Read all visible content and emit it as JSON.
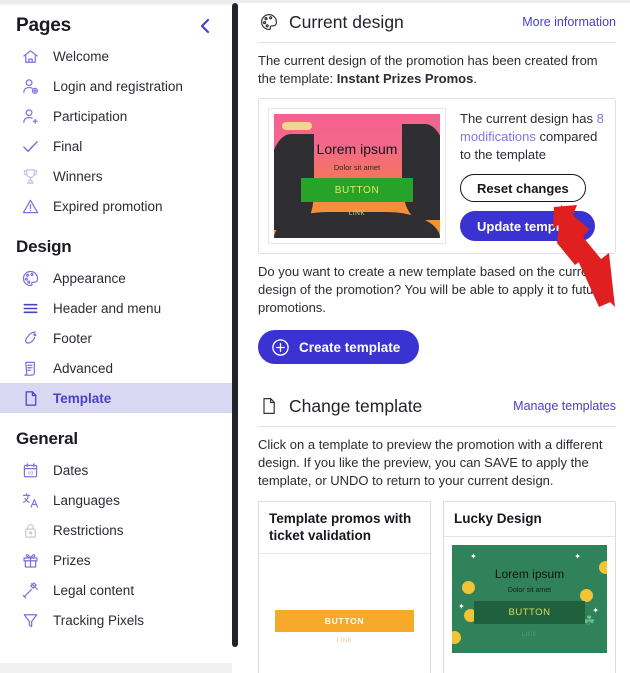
{
  "sidebar": {
    "title": "Pages",
    "collapse_icon": "chevron-left-icon",
    "groups": [
      {
        "heading": null,
        "items": [
          {
            "label": "Welcome",
            "icon": "home-icon",
            "active": false
          },
          {
            "label": "Login and registration",
            "icon": "user-login-icon",
            "active": false
          },
          {
            "label": "Participation",
            "icon": "user-add-icon",
            "active": false
          },
          {
            "label": "Final",
            "icon": "check-icon",
            "active": false
          },
          {
            "label": "Winners",
            "icon": "trophy-icon",
            "active": false
          },
          {
            "label": "Expired promotion",
            "icon": "warning-triangle-icon",
            "active": false
          }
        ]
      },
      {
        "heading": "Design",
        "items": [
          {
            "label": "Appearance",
            "icon": "palette-icon",
            "active": false
          },
          {
            "label": "Header and menu",
            "icon": "menu-lines-icon",
            "active": false
          },
          {
            "label": "Footer",
            "icon": "footer-icon",
            "active": false
          },
          {
            "label": "Advanced",
            "icon": "document-settings-icon",
            "active": false
          },
          {
            "label": "Template",
            "icon": "page-icon",
            "active": true
          }
        ]
      },
      {
        "heading": "General",
        "items": [
          {
            "label": "Dates",
            "icon": "calendar-icon",
            "active": false
          },
          {
            "label": "Languages",
            "icon": "translate-icon",
            "active": false
          },
          {
            "label": "Restrictions",
            "icon": "lock-icon",
            "active": false,
            "dim": true
          },
          {
            "label": "Prizes",
            "icon": "gift-icon",
            "active": false
          },
          {
            "label": "Legal content",
            "icon": "gavel-icon",
            "active": false
          },
          {
            "label": "Tracking Pixels",
            "icon": "funnel-icon",
            "active": false
          }
        ]
      }
    ]
  },
  "current_design": {
    "icon": "palette-icon",
    "title": "Current design",
    "more_info_link": "More information",
    "description_prefix": "The current design of the promotion has been created from the template: ",
    "template_name": "Instant Prizes Promos",
    "description_suffix": ".",
    "preview": {
      "title": "Lorem ipsum",
      "subtitle": "Dolor sit amet",
      "button": "BUTTON",
      "link": "LINK",
      "bg_top_color": "#f4638f",
      "bg_bottom_color": "#f7952f",
      "button_color": "#27a329"
    },
    "status_prefix": "The current design has ",
    "modifications_link": "8 modifications",
    "status_suffix": " compared to the template",
    "reset_button": "Reset changes",
    "update_button": "Update template",
    "update_button_color": "#3a33d2"
  },
  "create_section": {
    "question": "Do you want to create a new template based on the current design of the promotion? You will be able to apply it to future promotions.",
    "create_button": "Create template",
    "create_icon": "plus-circle-icon"
  },
  "change_template": {
    "icon": "page-icon",
    "title": "Change template",
    "manage_link": "Manage templates",
    "description": "Click on a template to preview the promotion with a different design. If you like the preview, you can SAVE to apply the template, or UNDO to return to your current design.",
    "templates": [
      {
        "name": "Template promos with ticket validation",
        "style": "white",
        "button": "BUTTON",
        "link": "LINK",
        "button_color": "#f7a92b"
      },
      {
        "name": "Lucky Design",
        "style": "green",
        "title": "Lorem ipsum",
        "subtitle": "Dolor sit amet",
        "button": "BUTTON",
        "link": "LINK",
        "bg_color": "#2f8259",
        "button_color": "#20613d"
      }
    ]
  },
  "annotation": {
    "arrow": "red-arrow-pointing-to-update-template",
    "color": "#e02020"
  }
}
